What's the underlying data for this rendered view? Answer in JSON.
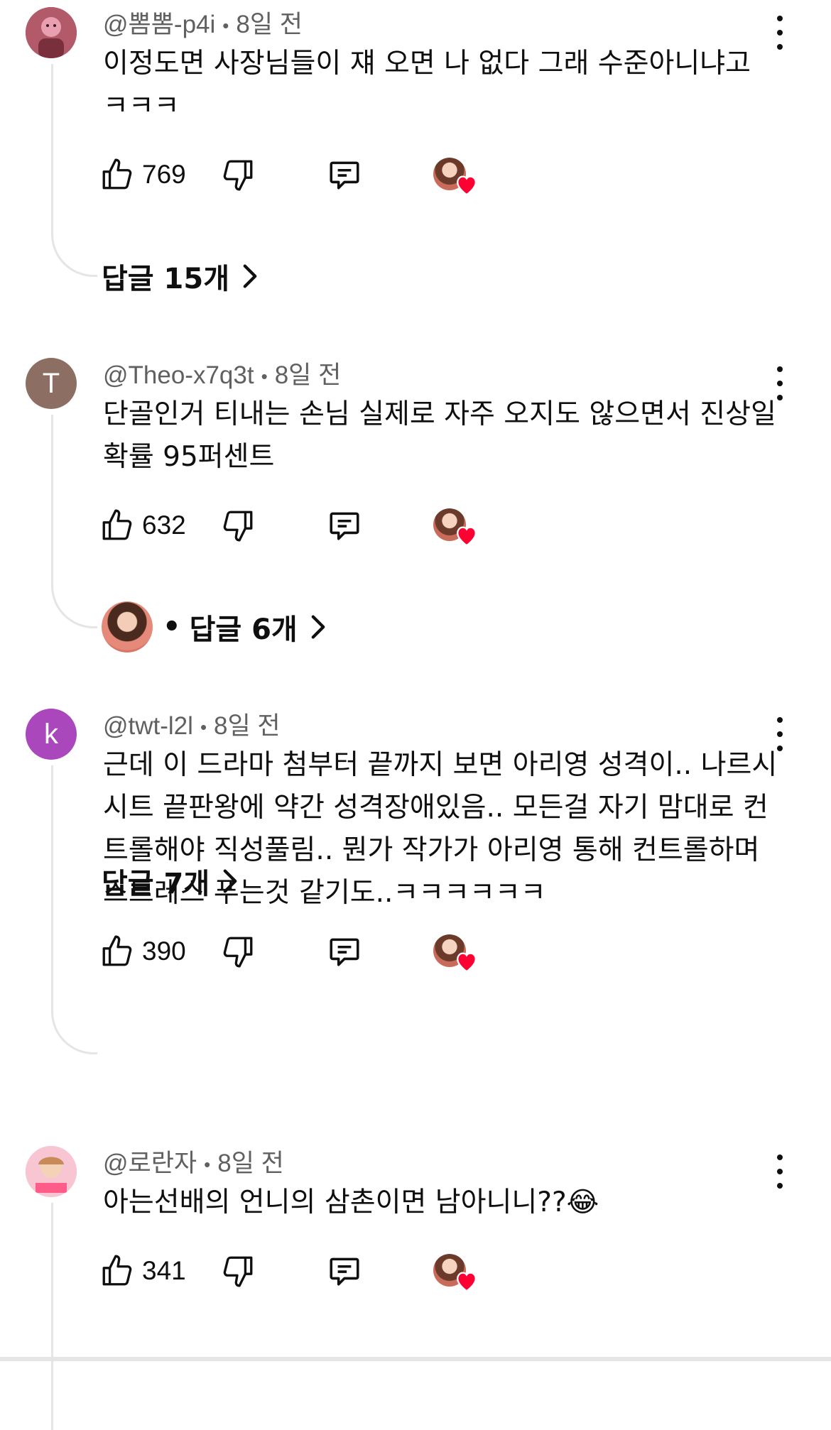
{
  "comments": [
    {
      "author": "@뽐뽐-p4i",
      "time": "8일 전",
      "text": "이정도면 사장님들이 쟤 오면 나 없다 그래 수준아니냐고 ㅋㅋㅋ",
      "likes": "769",
      "replies_label": "답글 15개",
      "avatar_letter": "",
      "avatar_color": "#9a4e5a"
    },
    {
      "author": "@Theo-x7q3t",
      "time": "8일 전",
      "text": "단골인거 티내는 손님 실제로 자주 오지도 않으면서 진상일 확률 95퍼센트",
      "likes": "632",
      "replies_label": "답글 6개",
      "avatar_letter": "T",
      "avatar_color": "#8d6e63"
    },
    {
      "author": "@twt-l2l",
      "time": "8일 전",
      "text": "근데 이 드라마 첨부터 끝까지 보면 아리영 성격이.. 나르시시트 끝판왕에 약간 성격장애있음.. 모든걸 자기 맘대로 컨트롤해야 직성풀림.. 뭔가 작가가 아리영 통해 컨트롤하며 스트레스 푸는것 같기도..ㅋㅋㅋㅋㅋㅋ",
      "likes": "390",
      "replies_label": "답글 7개",
      "avatar_letter": "k",
      "avatar_color": "#ab47bc"
    },
    {
      "author": "@로란자",
      "time": "8일 전",
      "text": "아는선배의 언니의 삼촌이면 남아니니??😂",
      "likes": "341",
      "replies_label": "",
      "avatar_letter": "",
      "avatar_color": "#f4a7b9"
    }
  ],
  "separator_dot": "•"
}
